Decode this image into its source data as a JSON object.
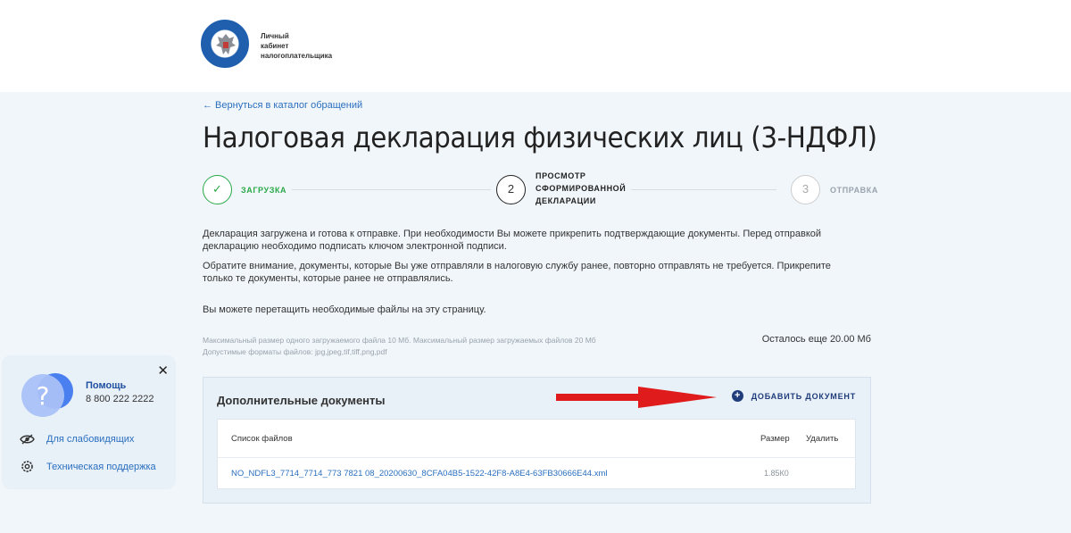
{
  "header": {
    "logo_lines": [
      "Личный",
      "кабинет",
      "налогоплательщика"
    ]
  },
  "back_link": "← Вернуться в каталог обращений",
  "page_title": "Налоговая декларация физических лиц (3-НДФЛ)",
  "steps": [
    {
      "number": "✓",
      "label": "ЗАГРУЗКА",
      "state": "done"
    },
    {
      "number": "2",
      "label": "ПРОСМОТР\nСФОРМИРОВАННОЙ\nДЕКЛАРАЦИИ",
      "state": "active"
    },
    {
      "number": "3",
      "label": "ОТПРАВКА",
      "state": "pending"
    }
  ],
  "info": {
    "p1": "Декларация загружена и готова к отправке. При необходимости Вы можете прикрепить подтверждающие документы. Перед отправкой декларацию необходимо подписать ключом электронной подписи.",
    "p2": "Обратите внимание, документы, которые Вы уже отправляли в налоговую службу ранее, повторно отправлять не требуется. Прикрепите только те документы, которые ранее не отправлялись.",
    "p3": "Вы можете перетащить необходимые файлы на эту страницу."
  },
  "limits": {
    "line1": "Максимальный размер одного загружаемого файла 10 Мб. Максимальный размер загружаемых файлов 20 Мб",
    "line2": "Допустимые форматы файлов: jpg,jpeg,tif,tiff,png,pdf",
    "remaining": "Осталось еще 20.00 Мб"
  },
  "docs": {
    "title": "Дополнительные документы",
    "add_label": "ДОБАВИТЬ ДОКУМЕНТ",
    "columns": [
      "Список файлов",
      "Размер",
      "Удалить"
    ],
    "rows": [
      {
        "file": "NO_NDFL3_7714_7714_773  7821    08_20200630_8CFA04B5-1522-42F8-A8E4-63FB30666E44.xml",
        "size": "1.85К0"
      }
    ]
  },
  "help": {
    "title": "Помощь",
    "phone": "8 800 222 2222",
    "low_vision": "Для слабовидящих",
    "support": "Техническая поддержка"
  },
  "colors": {
    "accent": "#2a6fbf",
    "success": "#2aa84a",
    "arrow": "#e01b1b",
    "brand": "#1f3d7a"
  }
}
